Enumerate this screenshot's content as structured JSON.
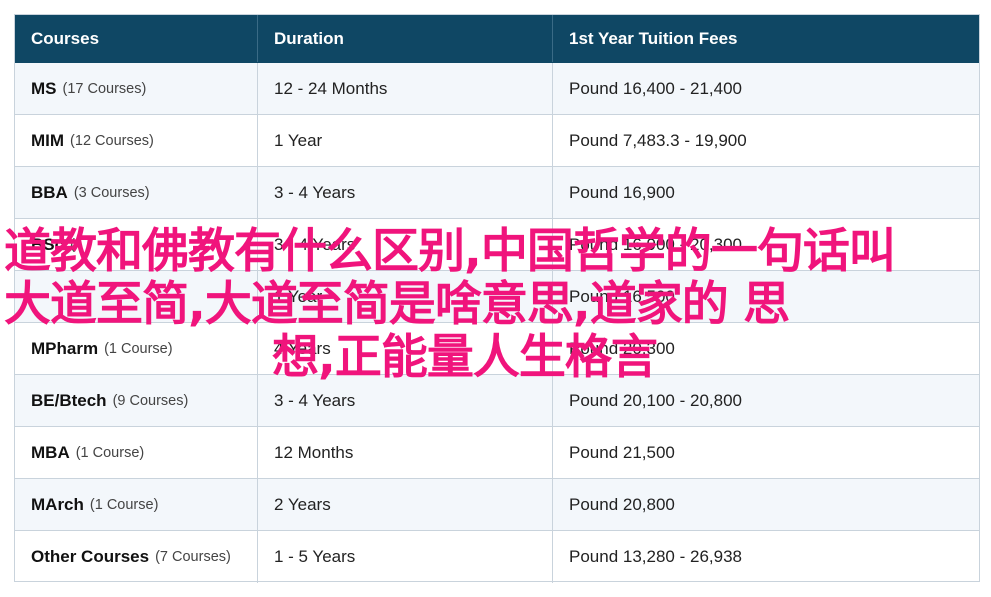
{
  "table": {
    "headers": [
      "Courses",
      "Duration",
      "1st Year Tuition Fees"
    ],
    "rows": [
      {
        "course": "MS",
        "count": "(17 Courses)",
        "duration": "12 - 24 Months",
        "fees": "Pound 16,400 - 21,400"
      },
      {
        "course": "MIM",
        "count": "(12 Courses)",
        "duration": "1 Year",
        "fees": "Pound 7,483.3 - 19,900"
      },
      {
        "course": "BBA",
        "count": "(3 Courses)",
        "duration": "3 - 4 Years",
        "fees": "Pound 16,900"
      },
      {
        "course": "BSc",
        "count": "(",
        "duration": "3 - 4 Years",
        "fees": "Pound 16,900 - 20,300"
      },
      {
        "course": "",
        "count": "",
        "duration": "1 Year",
        "fees": "Pound 16,500"
      },
      {
        "course": "MPharm",
        "count": "(1 Course)",
        "duration": "4 Years",
        "fees": "Pound 20,300"
      },
      {
        "course": "BE/Btech",
        "count": "(9 Courses)",
        "duration": "3 - 4 Years",
        "fees": "Pound 20,100 - 20,800"
      },
      {
        "course": "MBA",
        "count": "(1 Course)",
        "duration": "12 Months",
        "fees": "Pound 21,500"
      },
      {
        "course": "MArch",
        "count": "(1 Course)",
        "duration": "2 Years",
        "fees": "Pound 20,800"
      },
      {
        "course": "Other Courses",
        "count": "(7 Courses)",
        "duration": "1 - 5 Years",
        "fees": "Pound 13,280 - 26,938"
      }
    ]
  },
  "overlay": {
    "lines": [
      "道教和佛教有什么区别,中国哲学的一句话叫",
      "大道至简,大道至简是啥意思,道家的 思",
      "想,正能量人生格言"
    ],
    "color": "#f0147c"
  },
  "colors": {
    "header_bg": "#0f4764",
    "alt_row_bg": "#f3f7fb",
    "border": "#c9d3dc"
  }
}
